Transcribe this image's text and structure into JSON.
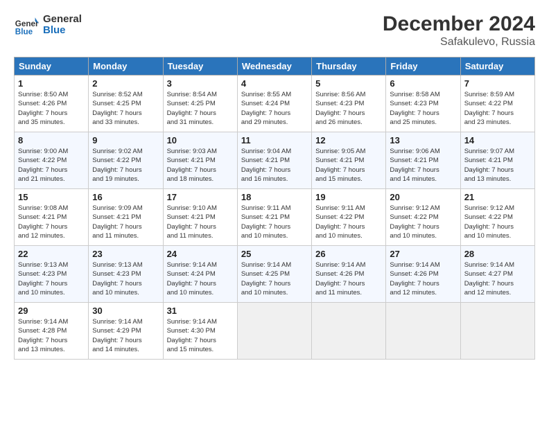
{
  "header": {
    "logo_line1": "General",
    "logo_line2": "Blue",
    "title": "December 2024",
    "subtitle": "Safakulevo, Russia"
  },
  "weekdays": [
    "Sunday",
    "Monday",
    "Tuesday",
    "Wednesday",
    "Thursday",
    "Friday",
    "Saturday"
  ],
  "weeks": [
    [
      {
        "day": "1",
        "info": "Sunrise: 8:50 AM\nSunset: 4:26 PM\nDaylight: 7 hours\nand 35 minutes."
      },
      {
        "day": "2",
        "info": "Sunrise: 8:52 AM\nSunset: 4:25 PM\nDaylight: 7 hours\nand 33 minutes."
      },
      {
        "day": "3",
        "info": "Sunrise: 8:54 AM\nSunset: 4:25 PM\nDaylight: 7 hours\nand 31 minutes."
      },
      {
        "day": "4",
        "info": "Sunrise: 8:55 AM\nSunset: 4:24 PM\nDaylight: 7 hours\nand 29 minutes."
      },
      {
        "day": "5",
        "info": "Sunrise: 8:56 AM\nSunset: 4:23 PM\nDaylight: 7 hours\nand 26 minutes."
      },
      {
        "day": "6",
        "info": "Sunrise: 8:58 AM\nSunset: 4:23 PM\nDaylight: 7 hours\nand 25 minutes."
      },
      {
        "day": "7",
        "info": "Sunrise: 8:59 AM\nSunset: 4:22 PM\nDaylight: 7 hours\nand 23 minutes."
      }
    ],
    [
      {
        "day": "8",
        "info": "Sunrise: 9:00 AM\nSunset: 4:22 PM\nDaylight: 7 hours\nand 21 minutes."
      },
      {
        "day": "9",
        "info": "Sunrise: 9:02 AM\nSunset: 4:22 PM\nDaylight: 7 hours\nand 19 minutes."
      },
      {
        "day": "10",
        "info": "Sunrise: 9:03 AM\nSunset: 4:21 PM\nDaylight: 7 hours\nand 18 minutes."
      },
      {
        "day": "11",
        "info": "Sunrise: 9:04 AM\nSunset: 4:21 PM\nDaylight: 7 hours\nand 16 minutes."
      },
      {
        "day": "12",
        "info": "Sunrise: 9:05 AM\nSunset: 4:21 PM\nDaylight: 7 hours\nand 15 minutes."
      },
      {
        "day": "13",
        "info": "Sunrise: 9:06 AM\nSunset: 4:21 PM\nDaylight: 7 hours\nand 14 minutes."
      },
      {
        "day": "14",
        "info": "Sunrise: 9:07 AM\nSunset: 4:21 PM\nDaylight: 7 hours\nand 13 minutes."
      }
    ],
    [
      {
        "day": "15",
        "info": "Sunrise: 9:08 AM\nSunset: 4:21 PM\nDaylight: 7 hours\nand 12 minutes."
      },
      {
        "day": "16",
        "info": "Sunrise: 9:09 AM\nSunset: 4:21 PM\nDaylight: 7 hours\nand 11 minutes."
      },
      {
        "day": "17",
        "info": "Sunrise: 9:10 AM\nSunset: 4:21 PM\nDaylight: 7 hours\nand 11 minutes."
      },
      {
        "day": "18",
        "info": "Sunrise: 9:11 AM\nSunset: 4:21 PM\nDaylight: 7 hours\nand 10 minutes."
      },
      {
        "day": "19",
        "info": "Sunrise: 9:11 AM\nSunset: 4:22 PM\nDaylight: 7 hours\nand 10 minutes."
      },
      {
        "day": "20",
        "info": "Sunrise: 9:12 AM\nSunset: 4:22 PM\nDaylight: 7 hours\nand 10 minutes."
      },
      {
        "day": "21",
        "info": "Sunrise: 9:12 AM\nSunset: 4:22 PM\nDaylight: 7 hours\nand 10 minutes."
      }
    ],
    [
      {
        "day": "22",
        "info": "Sunrise: 9:13 AM\nSunset: 4:23 PM\nDaylight: 7 hours\nand 10 minutes."
      },
      {
        "day": "23",
        "info": "Sunrise: 9:13 AM\nSunset: 4:23 PM\nDaylight: 7 hours\nand 10 minutes."
      },
      {
        "day": "24",
        "info": "Sunrise: 9:14 AM\nSunset: 4:24 PM\nDaylight: 7 hours\nand 10 minutes."
      },
      {
        "day": "25",
        "info": "Sunrise: 9:14 AM\nSunset: 4:25 PM\nDaylight: 7 hours\nand 10 minutes."
      },
      {
        "day": "26",
        "info": "Sunrise: 9:14 AM\nSunset: 4:26 PM\nDaylight: 7 hours\nand 11 minutes."
      },
      {
        "day": "27",
        "info": "Sunrise: 9:14 AM\nSunset: 4:26 PM\nDaylight: 7 hours\nand 12 minutes."
      },
      {
        "day": "28",
        "info": "Sunrise: 9:14 AM\nSunset: 4:27 PM\nDaylight: 7 hours\nand 12 minutes."
      }
    ],
    [
      {
        "day": "29",
        "info": "Sunrise: 9:14 AM\nSunset: 4:28 PM\nDaylight: 7 hours\nand 13 minutes."
      },
      {
        "day": "30",
        "info": "Sunrise: 9:14 AM\nSunset: 4:29 PM\nDaylight: 7 hours\nand 14 minutes."
      },
      {
        "day": "31",
        "info": "Sunrise: 9:14 AM\nSunset: 4:30 PM\nDaylight: 7 hours\nand 15 minutes."
      },
      {
        "day": "",
        "info": ""
      },
      {
        "day": "",
        "info": ""
      },
      {
        "day": "",
        "info": ""
      },
      {
        "day": "",
        "info": ""
      }
    ]
  ]
}
